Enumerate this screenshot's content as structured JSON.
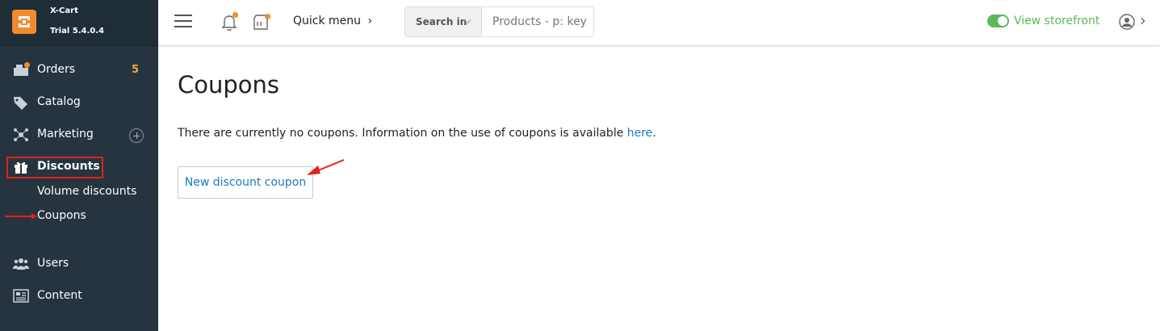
{
  "brand": {
    "name": "X-Cart",
    "version": "Trial 5.4.0.4"
  },
  "sidebar": {
    "items": [
      {
        "label": "Orders",
        "icon": "orders-icon",
        "count": "5"
      },
      {
        "label": "Catalog",
        "icon": "tag-icon"
      },
      {
        "label": "Marketing",
        "icon": "network-icon"
      },
      {
        "label": "Discounts",
        "icon": "gift-icon",
        "active": true
      },
      {
        "label": "Users",
        "icon": "users-icon"
      },
      {
        "label": "Content",
        "icon": "content-icon"
      }
    ],
    "discount_subitems": [
      "Volume discounts",
      "Coupons"
    ]
  },
  "topbar": {
    "quick_menu": "Quick menu",
    "search_in": "Search in",
    "search_placeholder": "Products - p: key",
    "view_storefront": "View storefront"
  },
  "main": {
    "title": "Coupons",
    "info_text": "There are currently no coupons. Information on the use of coupons is available ",
    "info_link": "here",
    "info_end": ".",
    "new_button": "New discount coupon"
  },
  "colors": {
    "sidebar": "#25343f",
    "accent": "#f28b30",
    "link": "#1a7bbf",
    "green": "#5cb85c",
    "annotation": "#e3201c"
  }
}
